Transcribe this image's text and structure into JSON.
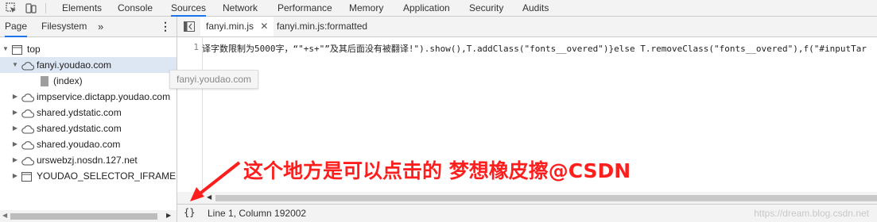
{
  "toolbar": {
    "main_tabs": [
      "Elements",
      "Console",
      "Sources",
      "Network",
      "Performance",
      "Memory",
      "Application",
      "Security",
      "Audits"
    ],
    "active_tab": "Sources"
  },
  "navigator": {
    "tabs": [
      "Page",
      "Filesystem"
    ],
    "more": "»",
    "menu": "⋮",
    "tree": [
      {
        "label": "top",
        "depth": 0,
        "expanded": true,
        "icon": "frame-icon"
      },
      {
        "label": "fanyi.youdao.com",
        "depth": 1,
        "expanded": true,
        "icon": "cloud-icon",
        "selected": true
      },
      {
        "label": "(index)",
        "depth": 2,
        "icon": "file-icon"
      },
      {
        "label": "impservice.dictapp.youdao.com",
        "depth": 1,
        "expanded": false,
        "icon": "cloud-icon"
      },
      {
        "label": "shared.ydstatic.com",
        "depth": 1,
        "expanded": false,
        "icon": "cloud-icon"
      },
      {
        "label": "shared.ydstatic.com",
        "depth": 1,
        "expanded": false,
        "icon": "cloud-icon"
      },
      {
        "label": "shared.youdao.com",
        "depth": 1,
        "expanded": false,
        "icon": "cloud-icon"
      },
      {
        "label": "urswebzj.nosdn.127.net",
        "depth": 1,
        "expanded": false,
        "icon": "cloud-icon"
      },
      {
        "label": "YOUDAO_SELECTOR_IFRAME (abc",
        "depth": 1,
        "expanded": false,
        "icon": "frame-icon"
      }
    ]
  },
  "tooltip": "fanyi.youdao.com",
  "editor": {
    "tabs": [
      {
        "label": "fanyi.min.js",
        "closable": true,
        "active": true
      },
      {
        "label": "fanyi.min.js:formatted",
        "closable": false,
        "active": false
      }
    ],
    "line_number": "1",
    "code_line": "译字数限制为5000字，“\"+s+\"”及其后面没有被翻译!\").show(),T.addClass(\"fonts__overed\")}else T.removeClass(\"fonts__overed\"),f(\"#inputTar"
  },
  "status": {
    "pretty_print": "{}",
    "position": "Line 1, Column 192002"
  },
  "annotation": "这个地方是可以点击的 梦想橡皮擦@CSDN",
  "watermark": "https://dream.blog.csdn.net",
  "colors": {
    "accent": "#1a73e8",
    "annotation": "#ff1e1e"
  }
}
